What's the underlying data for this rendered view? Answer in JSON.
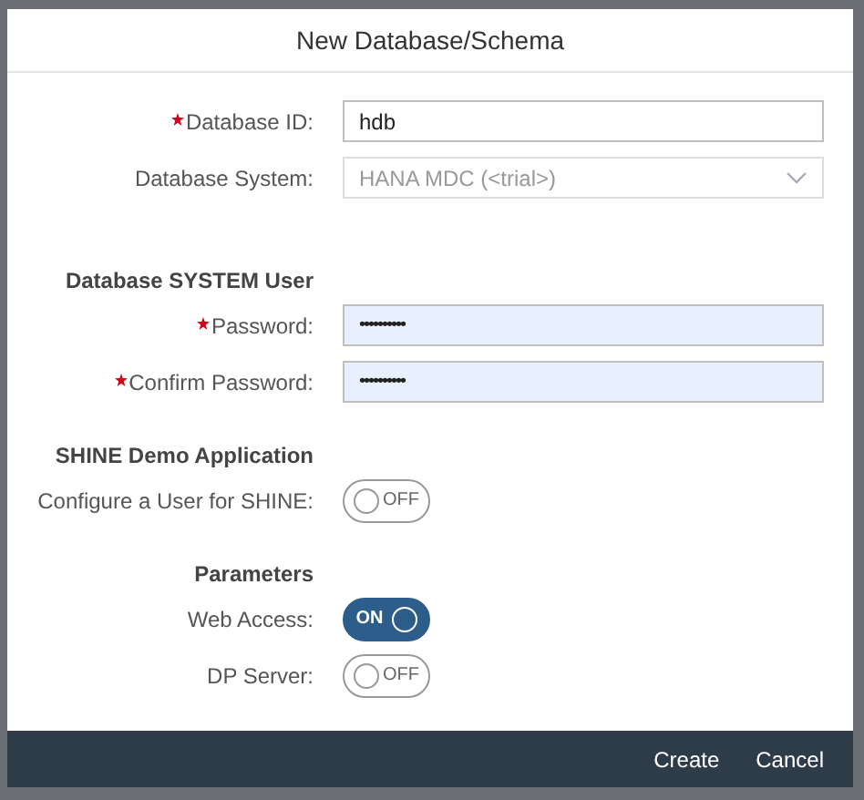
{
  "dialog": {
    "title": "New Database/Schema"
  },
  "rows": [
    {
      "kind": "text",
      "label": "Database ID:",
      "required": true,
      "value": "hdb"
    },
    {
      "kind": "select",
      "label": "Database System:",
      "required": false,
      "value": "HANA MDC (<trial>)",
      "disabled": true
    },
    {
      "kind": "heading",
      "label": "Database SYSTEM User"
    },
    {
      "kind": "password",
      "label": "Password:",
      "required": true,
      "value": "••••••••••"
    },
    {
      "kind": "password",
      "label": "Confirm Password:",
      "required": true,
      "value": "••••••••••"
    },
    {
      "kind": "heading",
      "label": "SHINE Demo Application"
    },
    {
      "kind": "toggle",
      "label": "Configure a User for SHINE:",
      "on": false,
      "state_text": "OFF"
    },
    {
      "kind": "heading",
      "label": "Parameters"
    },
    {
      "kind": "toggle",
      "label": "Web Access:",
      "on": true,
      "state_text": "ON"
    },
    {
      "kind": "toggle",
      "label": "DP Server:",
      "on": false,
      "state_text": "OFF"
    }
  ],
  "buttons": [
    "Create",
    "Cancel"
  ]
}
